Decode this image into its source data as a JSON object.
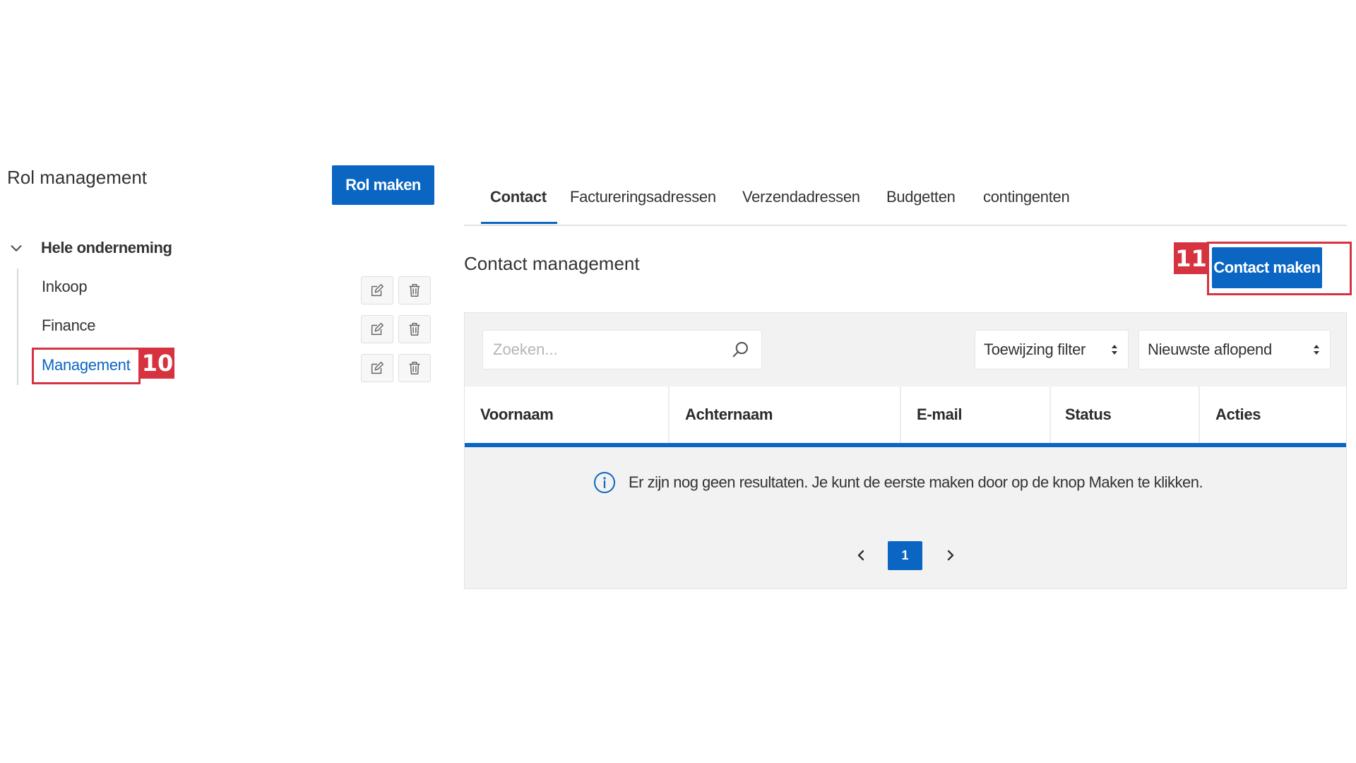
{
  "role_panel": {
    "title": "Rol management",
    "create_button": "Rol maken",
    "root_label": "Hele onderneming",
    "items": [
      {
        "label": "Inkoop"
      },
      {
        "label": "Finance"
      },
      {
        "label": "Management",
        "active": true
      }
    ]
  },
  "tabs": [
    "Contact",
    "Factureringsadressen",
    "Verzendadressen",
    "Budgetten",
    "contingenten"
  ],
  "active_tab": "Contact",
  "contact": {
    "title": "Contact management",
    "create_button": "Contact maken",
    "search_placeholder": "Zoeken...",
    "filter_label": "Toewijzing filter",
    "sort_label": "Nieuwste aflopend",
    "columns": [
      "Voornaam",
      "Achternaam",
      "E-mail",
      "Status",
      "Acties"
    ],
    "empty_message": "Er zijn nog geen resultaten. Je kunt de eerste maken door op de knop Maken te klikken.",
    "current_page": "1"
  },
  "annotations": {
    "step_10": "10",
    "step_11": "11"
  },
  "colors": {
    "primary": "#0a66c2",
    "highlight": "#d6323f",
    "panel_bg": "#f2f2f2"
  }
}
